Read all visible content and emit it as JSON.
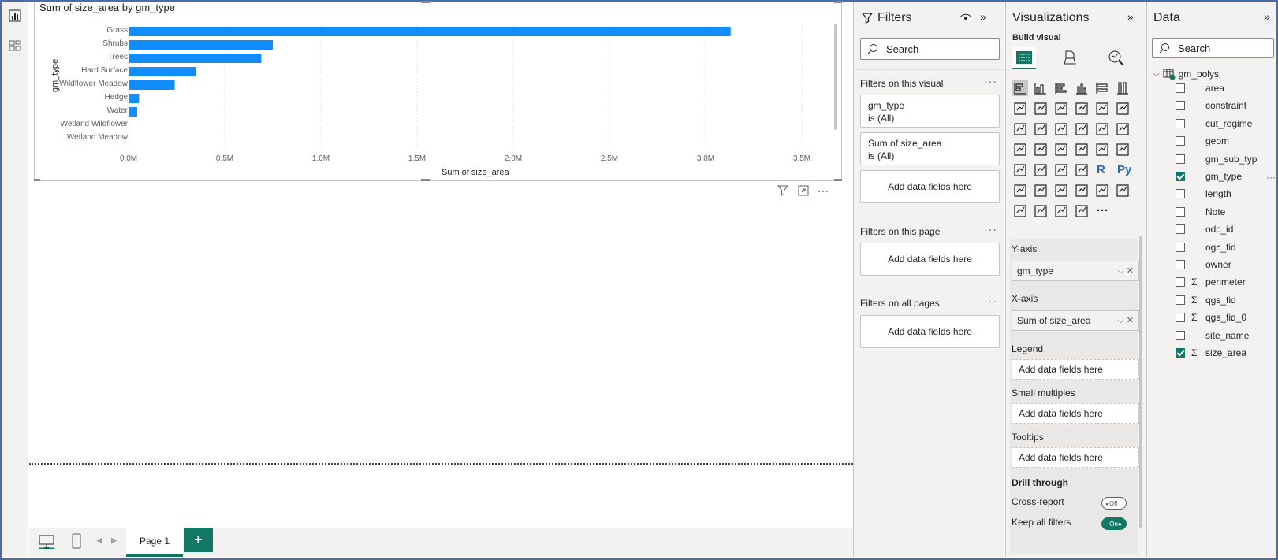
{
  "visual": {
    "title": "Sum of size_area by gm_type"
  },
  "chart_data": {
    "type": "bar",
    "orientation": "horizontal",
    "title": "Sum of size_area by gm_type",
    "xlabel": "Sum of size_area",
    "ylabel": "gm_type",
    "categories": [
      "Grass",
      "Shrubs",
      "Trees",
      "Hard Surface",
      "Wildflower Meadow",
      "Hedge",
      "Water",
      "Wetland Wildflower",
      "Wetland Meadow"
    ],
    "values": [
      3130000,
      750000,
      690000,
      350000,
      240000,
      55000,
      45000,
      4000,
      3000
    ],
    "xlim": [
      0,
      3500000
    ],
    "xticks": [
      "0.0M",
      "0.5M",
      "1.0M",
      "1.5M",
      "2.0M",
      "2.5M",
      "3.0M",
      "3.5M"
    ],
    "grid": true,
    "bar_color": "#118DFF"
  },
  "pages": {
    "tab_label": "Page 1",
    "add_label": "+"
  },
  "filters": {
    "title": "Filters",
    "search_placeholder": "Search",
    "on_visual": "Filters on this visual",
    "cards": [
      {
        "field": "gm_type",
        "state": "is (All)"
      },
      {
        "field": "Sum of size_area",
        "state": "is (All)"
      }
    ],
    "add_fields": "Add data fields here",
    "on_page": "Filters on this page",
    "on_all": "Filters on all pages"
  },
  "viz": {
    "title": "Visualizations",
    "build_visual": "Build visual",
    "y_axis": "Y-axis",
    "y_field": "gm_type",
    "x_axis": "X-axis",
    "x_field": "Sum of size_area",
    "legend": "Legend",
    "small_multiples": "Small multiples",
    "tooltips": "Tooltips",
    "add_fields": "Add data fields here",
    "drill_through": "Drill through",
    "cross_report": "Cross-report",
    "cross_report_state": "Off",
    "keep_filters": "Keep all filters",
    "keep_filters_state": "On",
    "r_label": "R",
    "py_label": "Py",
    "more": "···"
  },
  "data": {
    "title": "Data",
    "search_placeholder": "Search",
    "table": "gm_polys",
    "fields": [
      {
        "name": "area",
        "sigma": false,
        "checked": false
      },
      {
        "name": "constraint",
        "sigma": false,
        "checked": false
      },
      {
        "name": "cut_regime",
        "sigma": false,
        "checked": false
      },
      {
        "name": "geom",
        "sigma": false,
        "checked": false
      },
      {
        "name": "gm_sub_typ",
        "sigma": false,
        "checked": false
      },
      {
        "name": "gm_type",
        "sigma": false,
        "checked": true
      },
      {
        "name": "length",
        "sigma": false,
        "checked": false
      },
      {
        "name": "Note",
        "sigma": false,
        "checked": false
      },
      {
        "name": "odc_id",
        "sigma": false,
        "checked": false
      },
      {
        "name": "ogc_fid",
        "sigma": false,
        "checked": false
      },
      {
        "name": "owner",
        "sigma": false,
        "checked": false
      },
      {
        "name": "perimeter",
        "sigma": true,
        "checked": false
      },
      {
        "name": "qgs_fid",
        "sigma": true,
        "checked": false
      },
      {
        "name": "qgs_fid_0",
        "sigma": true,
        "checked": false
      },
      {
        "name": "site_name",
        "sigma": false,
        "checked": false
      },
      {
        "name": "size_area",
        "sigma": true,
        "checked": true
      }
    ],
    "sigma_symbol": "Σ"
  },
  "colors": {
    "accent": "#117865",
    "bar": "#118DFF"
  }
}
